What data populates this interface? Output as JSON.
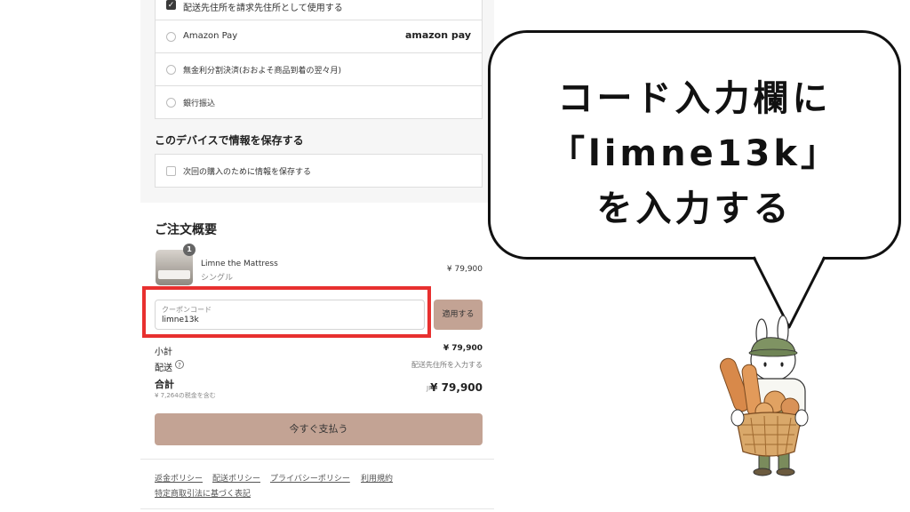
{
  "billing": {
    "same_as_shipping_label": "配送先住所を請求先住所として使用する",
    "payment_options": [
      {
        "label": "Amazon Pay",
        "logo": "amazon pay"
      },
      {
        "label": "無金利分割決済(おおよそ商品到着の翌々月)"
      },
      {
        "label": "銀行振込"
      }
    ]
  },
  "save_info": {
    "heading": "このデバイスで情報を保存する",
    "checkbox_label": "次回の購入のために情報を保存する"
  },
  "summary": {
    "heading": "ご注文概要",
    "product": {
      "qty": "1",
      "name": "Limne the Mattress",
      "variant": "シングル",
      "price": "¥ 79,900"
    },
    "coupon": {
      "label": "クーポンコード",
      "value": "limne13k",
      "apply_label": "適用する"
    },
    "subtotal_label": "小計",
    "subtotal_value": "¥ 79,900",
    "shipping_label": "配送",
    "shipping_value": "配送先住所を入力する",
    "total_label": "合計",
    "tax_note": "¥ 7,264の税金を含む",
    "currency": "JPY",
    "total_value": "¥ 79,900",
    "pay_button": "今すぐ支払う"
  },
  "footer_links": [
    "返金ポリシー",
    "配送ポリシー",
    "プライバシーポリシー",
    "利用規約",
    "特定商取引法に基づく表記"
  ],
  "callout": {
    "line1": "コード入力欄に",
    "line2": "「limne13k」",
    "line3": "を入力する"
  },
  "colors": {
    "accent_button": "#c3a394",
    "highlight_box": "#e8302f"
  }
}
